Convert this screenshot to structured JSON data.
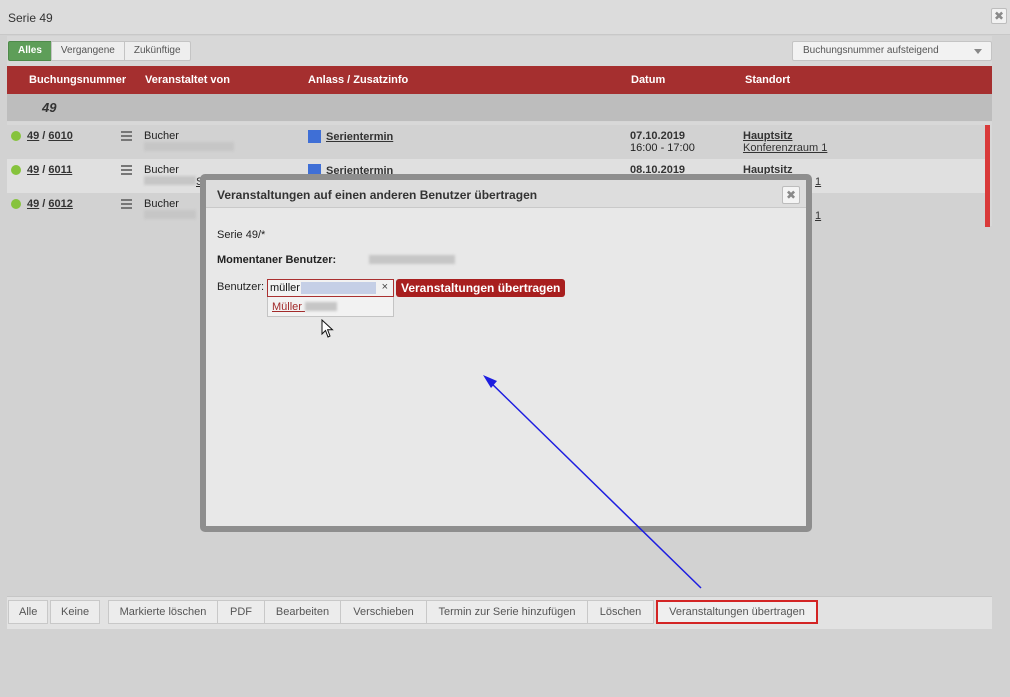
{
  "window": {
    "title": "Serie 49",
    "close": "✖"
  },
  "filters": {
    "items": [
      "Alles",
      "Vergangene",
      "Zukünftige"
    ],
    "active": "Alles"
  },
  "sort": {
    "selected": "Buchungsnummer aufsteigend"
  },
  "table": {
    "headers": [
      "Buchungsnummer",
      "Veranstaltet von",
      "Anlass / Zusatzinfo",
      "Datum",
      "Standort"
    ],
    "group": "49",
    "rows": [
      {
        "serie": "49",
        "sep": " / ",
        "nr": "6010",
        "bucher": "Bucher",
        "anlass": "Serientermin",
        "date": "07.10.2019",
        "time": "16:00 - 17:00",
        "standort": "Hauptsitz",
        "raum": "Konferenzraum 1"
      },
      {
        "serie": "49",
        "sep": " / ",
        "nr": "6011",
        "bucher": "Bucher",
        "bucher_tail": "S",
        "anlass": "Serientermin",
        "date": "08.10.2019",
        "standort": "Hauptsitz",
        "raum_tail": "1"
      },
      {
        "serie": "49",
        "sep": " / ",
        "nr": "6012",
        "bucher": "Bucher",
        "raum_tail": "1"
      }
    ],
    "colors": {
      "header_bg": "#a52f2f",
      "status_dot": "#86c33c",
      "anlass_square": "#3f6fd6"
    }
  },
  "modal": {
    "title": "Veranstaltungen auf einen anderen Benutzer übertragen",
    "close": "✖",
    "serie": "Serie 49/*",
    "current_user_label": "Momentaner Benutzer:",
    "user_label": "Benutzer:",
    "user_input_value": "müller",
    "clear": "×",
    "submit_label": "Veranstaltungen übertragen",
    "suggestion": "Müller"
  },
  "toolbar": {
    "buttons": [
      "Alle",
      "Keine",
      "Markierte löschen",
      "PDF",
      "Bearbeiten",
      "Verschieben",
      "Termin zur Serie hinzufügen",
      "Löschen",
      "Veranstaltungen übertragen"
    ],
    "highlighted": "Veranstaltungen übertragen"
  },
  "icons": {
    "close": "close-icon",
    "menu": "hamburger-icon",
    "cursor": "mouse-cursor-icon",
    "annotation": "blue-arrow"
  }
}
